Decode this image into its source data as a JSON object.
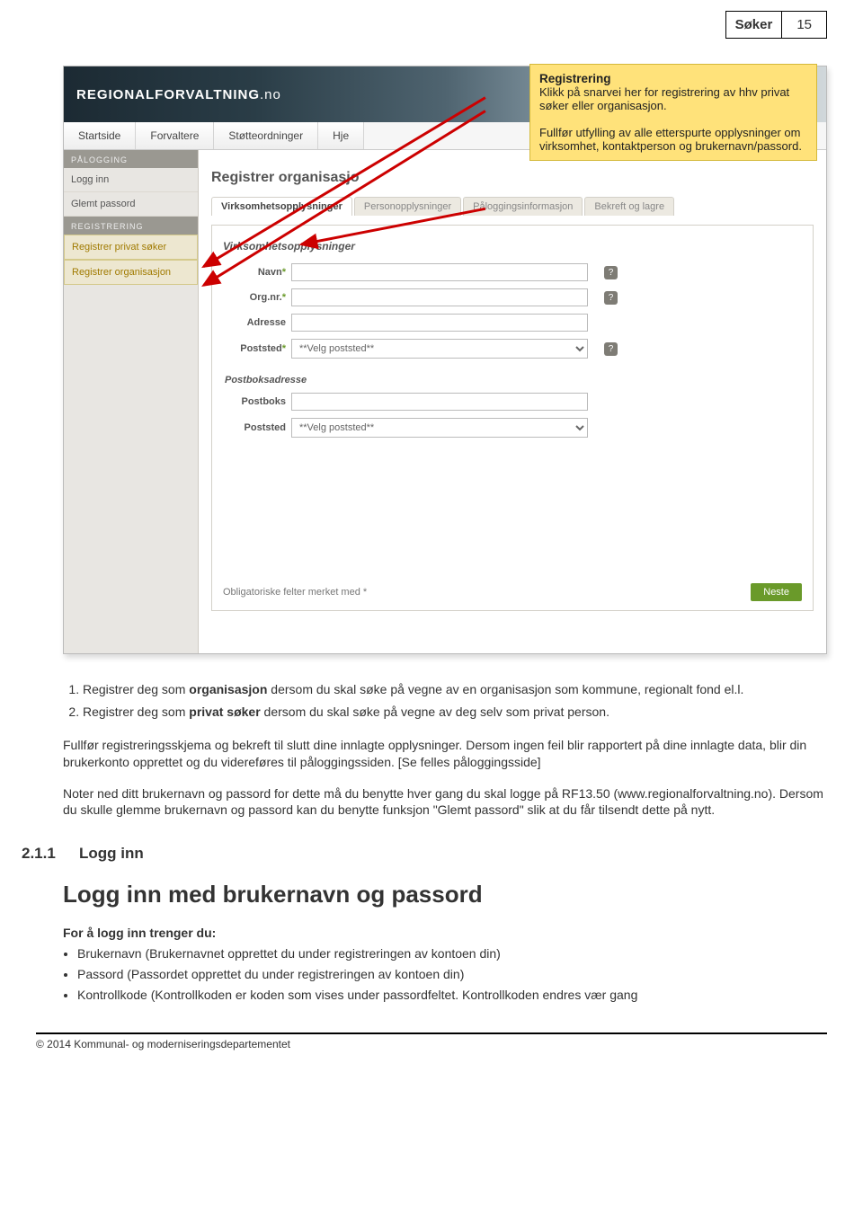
{
  "page_header": {
    "label": "Søker",
    "number": "15"
  },
  "screenshot": {
    "brand": "REGIONALFORVALTNING",
    "brand_suffix": ".no",
    "topnav": [
      "Startside",
      "Forvaltere",
      "Støtteordninger",
      "Hje"
    ],
    "sidebar": {
      "sec1": "PÅLOGGING",
      "items1": [
        "Logg inn",
        "Glemt passord"
      ],
      "sec2": "REGISTRERING",
      "items2": [
        "Registrer privat søker",
        "Registrer organisasjon"
      ]
    },
    "content_title": "Registrer organisasjo",
    "form_tabs": [
      "Virksomhetsopplysninger",
      "Personopplysninger",
      "Påloggingsinformasjon",
      "Bekreft og lagre"
    ],
    "panel_title": "Virksomhetsopplysninger",
    "labels": {
      "navn": "Navn",
      "orgnr": "Org.nr.",
      "adresse": "Adresse",
      "poststed": "Poststed",
      "postboks_h": "Postboksadresse",
      "postboks": "Postboks",
      "poststed2": "Poststed"
    },
    "placeholders": {
      "poststed": "**Velg poststed**",
      "poststed2": "**Velg poststed**"
    },
    "form_footer": {
      "note": "Obligatoriske felter merket med *",
      "next": "Neste"
    },
    "callout": {
      "title": "Registrering",
      "p1": "Klikk på snarvei her for registrering av hhv privat søker eller organisasjon.",
      "p2": "Fullfør utfylling av alle etterspurte opplysninger om virksomhet, kontaktperson og brukernavn/passord."
    }
  },
  "doc": {
    "li1a": "Registrer deg som ",
    "li1b": "organisasjon",
    "li1c": " dersom du skal søke på vegne av en organisasjon som kommune, regionalt fond el.l.",
    "li2a": "Registrer deg som ",
    "li2b": "privat søker",
    "li2c": " dersom du skal søke på vegne av deg selv som privat person.",
    "p1": "Fullfør registreringsskjema og bekreft til slutt dine innlagte opplysninger. Dersom ingen feil blir rapportert på dine innlagte data, blir din brukerkonto opprettet og du videreføres til påloggingssiden. [Se felles påloggingsside]",
    "p2": "Noter ned ditt brukernavn og passord for dette må du benytte hver gang du skal logge på RF13.50 (www.regionalforvaltning.no). Dersom du skulle glemme brukernavn og passord kan du benytte funksjon \"Glemt passord\" slik at du får tilsendt dette på nytt.",
    "sec_num": "2.1.1",
    "sec_title": "Logg inn",
    "big_title": "Logg inn med brukernavn og passord",
    "sub_b": "For å logg inn trenger du:",
    "bullets": [
      "Brukernavn (Brukernavnet opprettet du under registreringen av kontoen din)",
      "Passord (Passordet opprettet du under registreringen av kontoen din)",
      "Kontrollkode (Kontrollkoden er koden som vises under passordfeltet. Kontrollkoden endres vær gang"
    ]
  },
  "footer": "© 2014 Kommunal- og moderniseringsdepartementet"
}
